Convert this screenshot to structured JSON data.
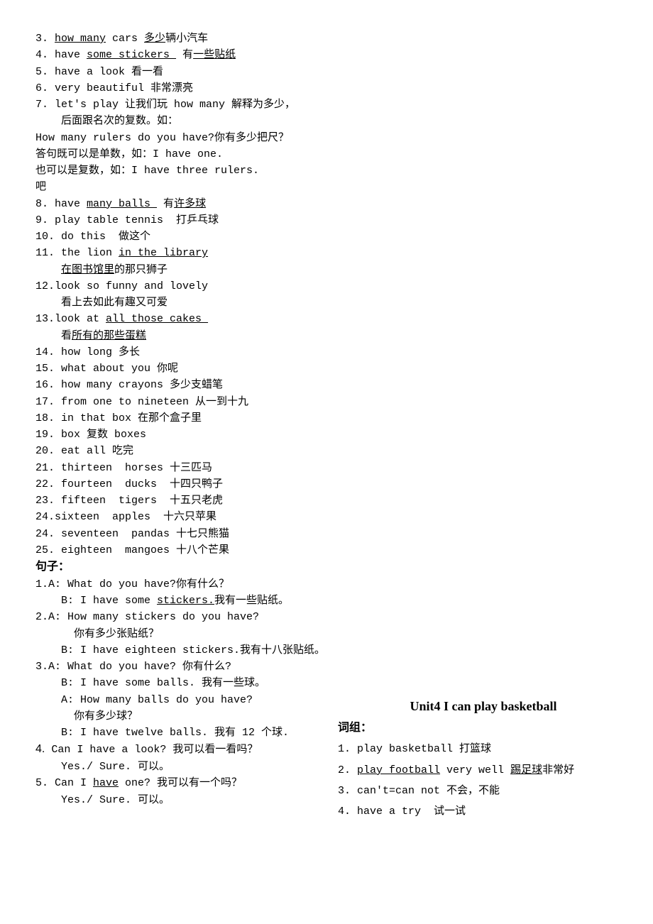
{
  "col1": {
    "lines": [
      {
        "pre": "3. ",
        "u": "how many",
        "post": " cars ",
        "u2": "多少",
        "post2": "辆小汽车"
      },
      {
        "pre": "4. have ",
        "u": "some stickers ",
        "post": " 有",
        "u2": "一些贴纸",
        "post2": ""
      },
      {
        "pre": "5. have a look 看一看"
      },
      {
        "pre": "6. very beautiful 非常漂亮"
      },
      {
        "pre": "7. let's play 让我们玩 how many 解释为多少，"
      },
      {
        "pre": "后面跟名次的复数。如：",
        "indent": true
      },
      {
        "pre": "How many rulers do you have?你有多少把尺？",
        "noindent": true
      },
      {
        "pre": "答句既可以是单数，如：I have one.",
        "noindent": true
      },
      {
        "pre": "也可以是复数，如：I have three rulers.",
        "noindent": true
      },
      {
        "pre": "吧",
        "noindent": true
      },
      {
        "pre": "8. have ",
        "u": "many balls ",
        "post": " 有",
        "u2": "许多球",
        "post2": ""
      },
      {
        "pre": "9. play table tennis  打乒乓球"
      },
      {
        "pre": "10. do this  做这个"
      },
      {
        "pre": "11. the lion ",
        "u": "in the library",
        "post": ""
      },
      {
        "pre": "",
        "u": "在图书馆里",
        "post": "的那只狮子",
        "indent": true
      },
      {
        "pre": "12.look so funny and lovely"
      },
      {
        "pre": "看上去如此有趣又可爱",
        "indent": true
      },
      {
        "pre": "13.look at ",
        "u": "all those cakes ",
        "post": ""
      },
      {
        "pre": "看",
        "u": "所有的那些蛋糕",
        "post": "",
        "indent": true
      },
      {
        "pre": "14. how long 多长"
      },
      {
        "pre": "15. what about you 你呢"
      },
      {
        "pre": "16. how many crayons 多少支蜡笔"
      },
      {
        "pre": "17. from one to nineteen 从一到十九"
      },
      {
        "pre": "18. in that box 在那个盒子里"
      },
      {
        "pre": "19. box 复数 boxes"
      },
      {
        "pre": "20. eat all 吃完"
      },
      {
        "pre": "21. thirteen  horses 十三匹马"
      },
      {
        "pre": "22. fourteen  ducks  十四只鸭子"
      },
      {
        "pre": "23. fifteen  tigers  十五只老虎"
      },
      {
        "pre": "24.sixteen  apples  十六只苹果"
      },
      {
        "pre": "24. seventeen  pandas 十七只熊猫"
      },
      {
        "pre": "25. eighteen  mangoes 十八个芒果"
      }
    ],
    "sent_header": "句子：",
    "sentences": [
      {
        "pre": "1.A: What do you have?你有什么？"
      },
      {
        "pre": "B: I have some ",
        "u": "stickers.",
        "post": "我有一些贴纸。",
        "indent": true
      },
      {
        "pre": "2.A: How many stickers do you have?"
      },
      {
        "pre": "你有多少张贴纸？",
        "indent2": true
      },
      {
        "pre": "B: I have eighteen stickers.我有十八张贴纸。",
        "indent": true
      },
      {
        "pre": "3.A: What do you have? 你有什么?"
      },
      {
        "pre": "B: I have some balls. 我有一些球。",
        "indent": true
      },
      {
        "pre": "A: How many balls do you have?",
        "indent": true
      },
      {
        "pre": "你有多少球？",
        "indent2": true
      },
      {
        "pre": "B: I have twelve balls. 我有 12 个球.",
        "indent": true
      },
      {
        "pre": "4. Can I have a look? 我可以看一看吗？",
        "bignum": true
      },
      {
        "pre": "Yes./ Sure. 可以。",
        "indent": true
      },
      {
        "pre": "5. Can I ",
        "u": "have",
        "post": " one? 我可以有一个吗？"
      },
      {
        "pre": "Yes./ Sure. 可以。",
        "indent": true
      }
    ]
  },
  "col2": {
    "unit_title": "Unit4 I can play basketball",
    "group_header": "词组：",
    "items": [
      {
        "pre": "1. play basketball 打篮球"
      },
      {
        "pre": "2. ",
        "u": "play football",
        "post": " very well ",
        "u2": "踢足球",
        "post2": "非常好"
      },
      {
        "pre": "3. can't=can not 不会，不能"
      },
      {
        "pre": "4. have a try  试一试"
      }
    ]
  }
}
